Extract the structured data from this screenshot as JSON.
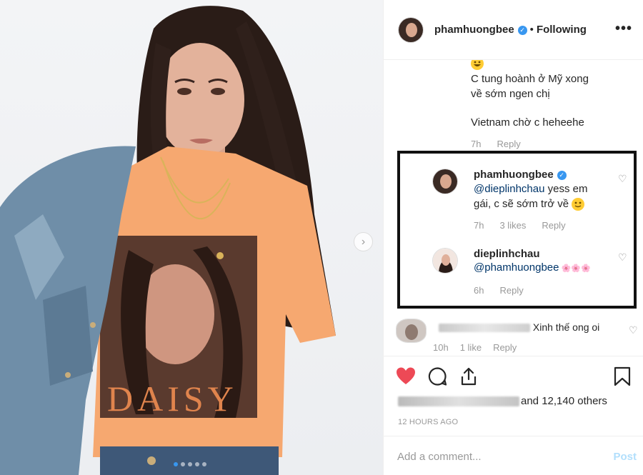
{
  "post": {
    "username": "phamhuongbee",
    "follow_status": "Following",
    "separator": "•",
    "more_icon": "•••",
    "next_icon": "›"
  },
  "comments": {
    "first": {
      "line1": "C tung hoành ở Mỹ xong",
      "line2": "về sớm ngen chị",
      "line3": "Vietnam chờ c heheehe",
      "time": "7h",
      "reply": "Reply"
    },
    "highlighted": [
      {
        "username": "phamhuongbee",
        "mention": "@dieplinhchau",
        "text_a": " yess em",
        "text_b": "gái, c sẽ sớm trở về",
        "time": "7h",
        "likes": "3 likes",
        "reply": "Reply"
      },
      {
        "username": "dieplinhchau",
        "mention": "@phamhuongbee",
        "text_a": " 🌸🌸🌸",
        "time": "6h",
        "reply": "Reply"
      }
    ],
    "last": {
      "text": "Xinh thế ong oi",
      "time": "10h",
      "likes": "1 like",
      "reply": "Reply"
    }
  },
  "actions": {
    "likes_suffix": "and 12,140 others",
    "timestamp": "12 HOURS AGO"
  },
  "add_comment": {
    "placeholder": "Add a comment...",
    "post_label": "Post"
  },
  "colors": {
    "like_red": "#ed4956",
    "verified_blue": "#3897f0",
    "link": "#003569",
    "post_disabled": "#b2dffc"
  },
  "icons": [
    "heart-icon",
    "comment-icon",
    "share-icon",
    "bookmark-icon",
    "verified-badge-icon",
    "more-options-icon"
  ]
}
